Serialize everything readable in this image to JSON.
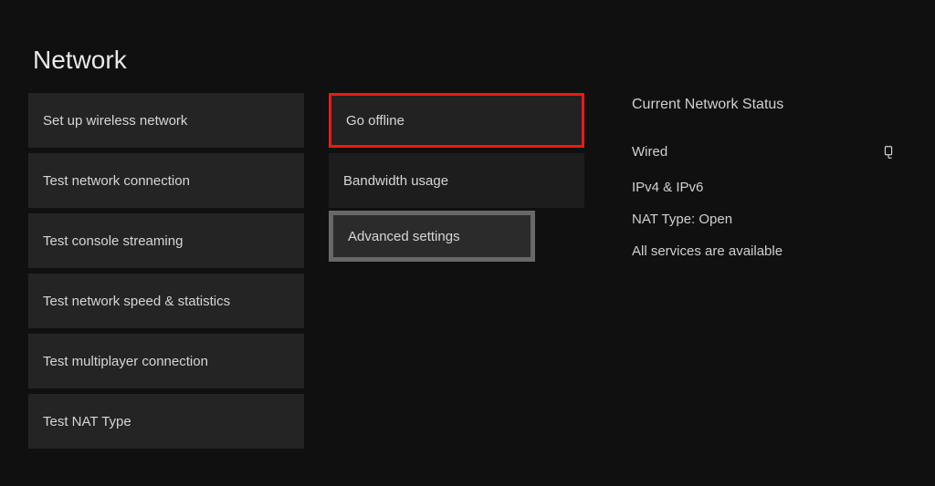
{
  "page": {
    "title": "Network"
  },
  "col1": {
    "items": [
      "Set up wireless network",
      "Test network connection",
      "Test console streaming",
      "Test network speed & statistics",
      "Test multiplayer connection",
      "Test NAT Type"
    ]
  },
  "col2": {
    "go_offline": "Go offline",
    "bandwidth": "Bandwidth usage",
    "advanced": "Advanced settings"
  },
  "status": {
    "heading": "Current Network Status",
    "connection": "Wired",
    "ip": "IPv4 & IPv6",
    "nat": "NAT Type: Open",
    "services": "All services are available"
  }
}
